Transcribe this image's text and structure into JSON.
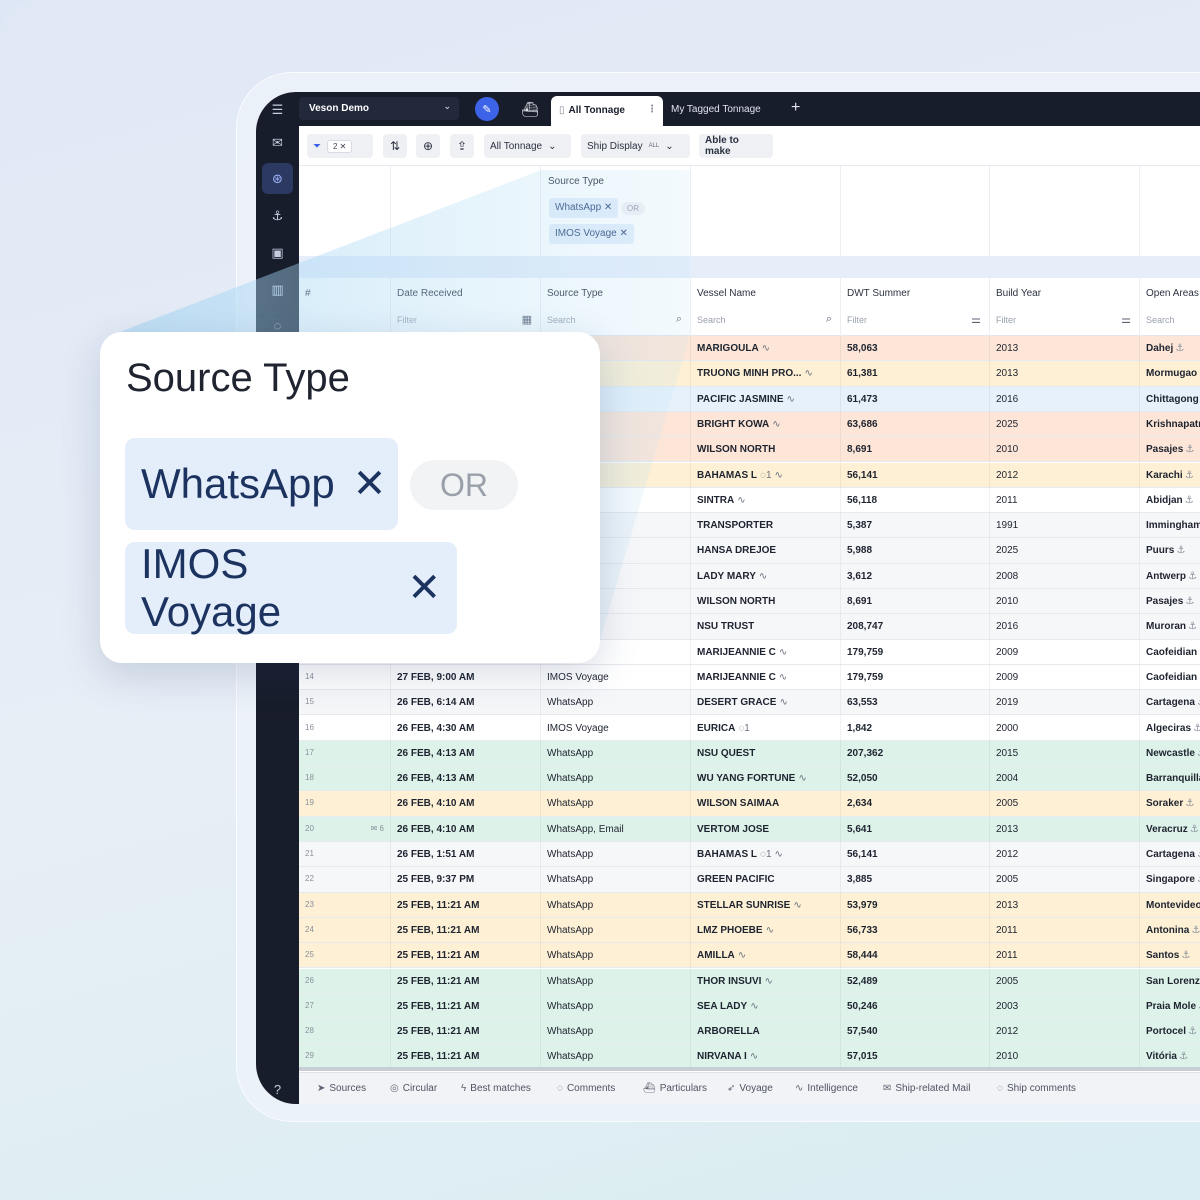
{
  "app": {
    "workspace": "Veson Demo",
    "tabs": [
      {
        "label": "All Tonnage",
        "active": true
      },
      {
        "label": "My Tagged Tonnage",
        "active": false
      }
    ],
    "accent_color": "#3d63e8"
  },
  "toolbar": {
    "filter_count": "2",
    "view_select": "All Tonnage",
    "ship_display_label": "Ship Display",
    "ship_display_value": "ALL",
    "able_to_make": "Able to make"
  },
  "filter_summary": {
    "title": "Source Type",
    "chips": [
      "WhatsApp",
      "IMOS Voyage"
    ],
    "operator": "OR"
  },
  "popup": {
    "title": "Source Type",
    "chips": [
      "WhatsApp",
      "IMOS Voyage"
    ],
    "operator": "OR"
  },
  "columns": [
    {
      "label": "#",
      "filter": ""
    },
    {
      "label": "Date Received",
      "filter": "Filter"
    },
    {
      "label": "Source Type",
      "filter": "Search"
    },
    {
      "label": "Vessel Name",
      "filter": "Search"
    },
    {
      "label": "DWT Summer",
      "filter": "Filter"
    },
    {
      "label": "Build Year",
      "filter": "Filter"
    },
    {
      "label": "Open Areas",
      "filter": "Search"
    }
  ],
  "rows": [
    {
      "idx": "",
      "date": "",
      "source": "",
      "vessel": "MARIGOULA",
      "pulse": true,
      "dwt": "58,063",
      "year": "2013",
      "area": "Dahej",
      "color": "orange"
    },
    {
      "idx": "",
      "date": "",
      "source": "",
      "vessel": "TRUONG MINH PRO...",
      "pulse": true,
      "dwt": "61,381",
      "year": "2013",
      "area": "Mormugao",
      "color": "yellow"
    },
    {
      "idx": "",
      "date": "",
      "source": "",
      "vessel": "PACIFIC JASMINE",
      "pulse": true,
      "dwt": "61,473",
      "year": "2016",
      "area": "Chittagong",
      "color": "blue"
    },
    {
      "idx": "",
      "date": "",
      "source": "",
      "vessel": "BRIGHT KOWA",
      "pulse": true,
      "dwt": "63,686",
      "year": "2025",
      "area": "Krishnapatnam",
      "color": "orange"
    },
    {
      "idx": "",
      "date": "",
      "source": "",
      "vessel": "WILSON NORTH",
      "pulse": false,
      "dwt": "8,691",
      "year": "2010",
      "area": "Pasajes",
      "color": "orange"
    },
    {
      "idx": "",
      "date": "",
      "source": "",
      "vessel": "BAHAMAS L",
      "comments": "1",
      "pulse": true,
      "dwt": "56,141",
      "year": "2012",
      "area": "Karachi",
      "color": "yellow"
    },
    {
      "idx": "",
      "date": "",
      "source": "ge",
      "vessel": "SINTRA",
      "pulse": true,
      "dwt": "56,118",
      "year": "2011",
      "area": "Abidjan",
      "color": "white"
    },
    {
      "idx": "",
      "date": "",
      "source": "",
      "vessel": "TRANSPORTER",
      "pulse": false,
      "dwt": "5,387",
      "year": "1991",
      "area": "Immingham",
      "color": "grey"
    },
    {
      "idx": "",
      "date": "",
      "source": "",
      "vessel": "HANSA DREJOE",
      "pulse": false,
      "dwt": "5,988",
      "year": "2025",
      "area": "Puurs",
      "color": "grey"
    },
    {
      "idx": "",
      "date": "",
      "source": "",
      "vessel": "LADY MARY",
      "pulse": true,
      "dwt": "3,612",
      "year": "2008",
      "area": "Antwerp",
      "color": "grey"
    },
    {
      "idx": "",
      "date": "",
      "source": "",
      "vessel": "WILSON NORTH",
      "pulse": false,
      "dwt": "8,691",
      "year": "2010",
      "area": "Pasajes",
      "color": "grey"
    },
    {
      "idx": "",
      "date": "",
      "source": "",
      "vessel": "NSU TRUST",
      "pulse": false,
      "dwt": "208,747",
      "year": "2016",
      "area": "Muroran",
      "color": "grey"
    },
    {
      "idx": "",
      "date": "",
      "source": "age",
      "vessel": "MARIJEANNIE C",
      "pulse": true,
      "dwt": "179,759",
      "year": "2009",
      "area": "Caofeidian",
      "color": "white"
    },
    {
      "idx": "14",
      "date": "27 FEB, 9:00 AM",
      "source": "IMOS Voyage",
      "vessel": "MARIJEANNIE C",
      "pulse": true,
      "dwt": "179,759",
      "year": "2009",
      "area": "Caofeidian",
      "color": "white"
    },
    {
      "idx": "15",
      "date": "26 FEB, 6:14 AM",
      "source": "WhatsApp",
      "vessel": "DESERT GRACE",
      "pulse": true,
      "dwt": "63,553",
      "year": "2019",
      "area": "Cartagena",
      "color": "grey"
    },
    {
      "idx": "16",
      "date": "26 FEB, 4:30 AM",
      "source": "IMOS Voyage",
      "vessel": "EURICA",
      "comments": "1",
      "pulse": false,
      "dwt": "1,842",
      "year": "2000",
      "area": "Algeciras",
      "color": "white"
    },
    {
      "idx": "17",
      "date": "26 FEB, 4:13 AM",
      "source": "WhatsApp",
      "vessel": "NSU QUEST",
      "pulse": false,
      "dwt": "207,362",
      "year": "2015",
      "area": "Newcastle",
      "color": "green"
    },
    {
      "idx": "18",
      "date": "26 FEB, 4:13 AM",
      "source": "WhatsApp",
      "vessel": "WU YANG FORTUNE",
      "pulse": true,
      "dwt": "52,050",
      "year": "2004",
      "area": "Barranquilla",
      "color": "green"
    },
    {
      "idx": "19",
      "date": "26 FEB, 4:10 AM",
      "source": "WhatsApp",
      "vessel": "WILSON SAIMAA",
      "pulse": false,
      "dwt": "2,634",
      "year": "2005",
      "area": "Soraker",
      "color": "yellow"
    },
    {
      "idx": "20",
      "mail": "6",
      "date": "26 FEB, 4:10 AM",
      "source": "WhatsApp, Email",
      "vessel": "VERTOM JOSE",
      "pulse": false,
      "dwt": "5,641",
      "year": "2013",
      "area": "Veracruz",
      "color": "green"
    },
    {
      "idx": "21",
      "date": "26 FEB, 1:51 AM",
      "source": "WhatsApp",
      "vessel": "BAHAMAS L",
      "comments": "1",
      "pulse": true,
      "dwt": "56,141",
      "year": "2012",
      "area": "Cartagena",
      "color": "grey"
    },
    {
      "idx": "22",
      "date": "25 FEB, 9:37 PM",
      "source": "WhatsApp",
      "vessel": "GREEN PACIFIC",
      "pulse": false,
      "dwt": "3,885",
      "year": "2005",
      "area": "Singapore",
      "color": "grey"
    },
    {
      "idx": "23",
      "date": "25 FEB, 11:21 AM",
      "source": "WhatsApp",
      "vessel": "STELLAR SUNRISE",
      "pulse": true,
      "dwt": "53,979",
      "year": "2013",
      "area": "Montevideo",
      "color": "yellow"
    },
    {
      "idx": "24",
      "date": "25 FEB, 11:21 AM",
      "source": "WhatsApp",
      "vessel": "LMZ PHOEBE",
      "pulse": true,
      "dwt": "56,733",
      "year": "2011",
      "area": "Antonina",
      "color": "yellow"
    },
    {
      "idx": "25",
      "date": "25 FEB, 11:21 AM",
      "source": "WhatsApp",
      "vessel": "AMILLA",
      "pulse": true,
      "dwt": "58,444",
      "year": "2011",
      "area": "Santos",
      "color": "yellow"
    },
    {
      "idx": "26",
      "date": "25 FEB, 11:21 AM",
      "source": "WhatsApp",
      "vessel": "THOR INSUVI",
      "pulse": true,
      "dwt": "52,489",
      "year": "2005",
      "area": "San Lorenzo",
      "color": "green"
    },
    {
      "idx": "27",
      "date": "25 FEB, 11:21 AM",
      "source": "WhatsApp",
      "vessel": "SEA LADY",
      "pulse": true,
      "dwt": "50,246",
      "year": "2003",
      "area": "Praia Mole",
      "color": "green"
    },
    {
      "idx": "28",
      "date": "25 FEB, 11:21 AM",
      "source": "WhatsApp",
      "vessel": "ARBORELLA",
      "pulse": false,
      "dwt": "57,540",
      "year": "2012",
      "area": "Portocel",
      "color": "green"
    },
    {
      "idx": "29",
      "date": "25 FEB, 11:21 AM",
      "source": "WhatsApp",
      "vessel": "NIRVANA I",
      "pulse": true,
      "dwt": "57,015",
      "year": "2010",
      "area": "Vitória",
      "color": "green"
    }
  ],
  "row_colors": {
    "orange": "#fde6d7",
    "yellow": "#fdf0d4",
    "blue": "#e6f1fb",
    "white": "#ffffff",
    "grey": "#f6f7f9",
    "green": "#ddf3e9"
  },
  "bottom_tabs": [
    {
      "label": "Sources",
      "icon": "send-icon"
    },
    {
      "label": "Circular",
      "icon": "circular-icon"
    },
    {
      "label": "Best matches",
      "icon": "bolt-icon"
    },
    {
      "label": "Comments",
      "icon": "comment-icon"
    },
    {
      "label": "Particulars",
      "icon": "ship-icon"
    },
    {
      "label": "Voyage",
      "icon": "navigation-icon"
    },
    {
      "label": "Intelligence",
      "icon": "pulse-icon"
    },
    {
      "label": "Ship-related Mail",
      "icon": "mail-icon"
    },
    {
      "label": "Ship comments",
      "icon": "comment-icon"
    }
  ]
}
